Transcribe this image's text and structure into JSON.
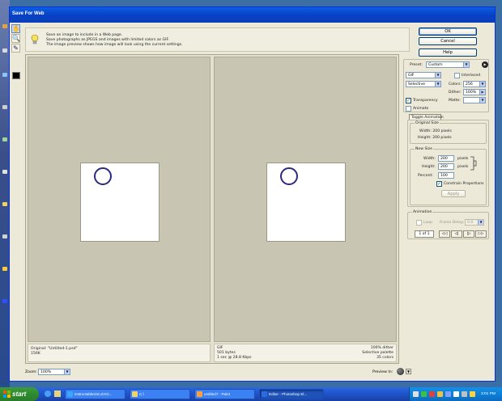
{
  "dialog": {
    "title": "Save For Web",
    "info_lines": [
      "Save an image to include in a Web page.",
      "Save photographs as JPEGS and images with limited colors as GIF.",
      "The image preview shows how image will look using the current settings."
    ]
  },
  "buttons": {
    "ok": "OK",
    "cancel": "Cancel",
    "help": "Help"
  },
  "settings": {
    "preset_label": "Preset:",
    "preset_value": "Custom",
    "format_value": "GIF",
    "interlaced_label": "Interlaced",
    "interlaced_checked": false,
    "reduction_value": "Selective",
    "colors_label": "Colors:",
    "colors_value": "256",
    "dither_label": "Dither:",
    "dither_value": "100%",
    "transparency_label": "Transparency",
    "transparency_checked": true,
    "matte_label": "Matte:",
    "matte_value": "",
    "animate_label": "Animate",
    "animate_checked": false
  },
  "toggle_animation_label": "Toggle Animation",
  "original_size": {
    "title": "Original Size",
    "width": "Width: 200 pixels",
    "height": "Height: 200 pixels"
  },
  "new_size": {
    "title": "New Size",
    "width_label": "Width:",
    "width_value": "200",
    "height_label": "Height:",
    "height_value": "200",
    "percent_label": "Percent:",
    "percent_value": "100",
    "unit": "pixels",
    "constrain_label": "Constrain Proportions",
    "constrain_checked": true,
    "apply_label": "Apply"
  },
  "animation": {
    "title": "Animation",
    "loop_label": "Loop",
    "frame_delay_label": "Frame Delay:",
    "frame_delay_value": "0.0",
    "frame_counter": "1 of 1",
    "controls": [
      "◁◁",
      "◁|",
      "|▷",
      "▷▷"
    ]
  },
  "preview": {
    "original": {
      "line1": "Original: \"Untitled-1.psd\"",
      "line2": "156K"
    },
    "optimized": {
      "line1": "GIF",
      "line2": "501 bytes",
      "line3": "1 sec @ 28.8 Kbps",
      "right1": "100% dither",
      "right2": "Selective palette",
      "right3": "35 colors"
    }
  },
  "footer": {
    "zoom_label": "Zoom:",
    "zoom_value": "100%",
    "preview_in_label": "Preview In:"
  },
  "taskbar": {
    "start_label": "start",
    "items": [
      {
        "label": "instructables/xl=EXG..."
      },
      {
        "label": "C:\\"
      },
      {
        "label": "untitled7 - Paint"
      },
      {
        "label": "Editor - Photoshop El..."
      }
    ],
    "clock": "3:01 PM"
  },
  "colors": {
    "titlebar": "#0a54d6",
    "dialog_bg": "#ece9d8",
    "pane_bg": "#c8c5b2",
    "circle": "#2a2a80",
    "taskbar": "#245edb",
    "start": "#2f8a2f"
  }
}
